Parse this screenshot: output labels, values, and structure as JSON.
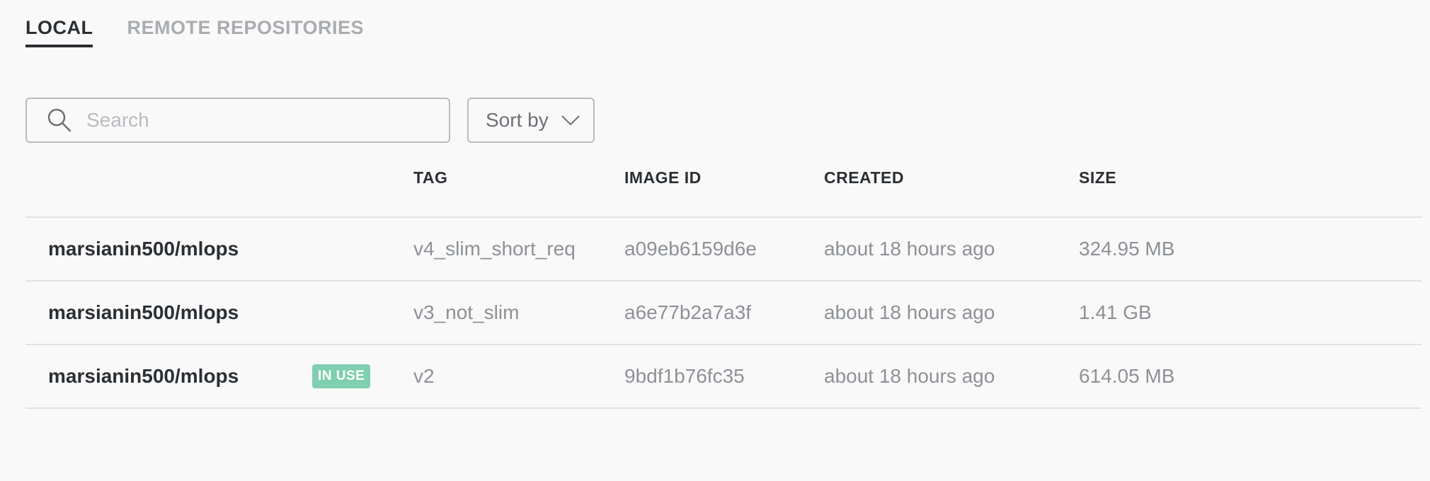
{
  "tabs": [
    {
      "label": "LOCAL",
      "active": true
    },
    {
      "label": "REMOTE REPOSITORIES",
      "active": false
    }
  ],
  "search": {
    "placeholder": "Search",
    "value": "",
    "icon": "search-icon"
  },
  "sort": {
    "label": "Sort by",
    "icon": "chevron-down-icon"
  },
  "table": {
    "columns": [
      "TAG",
      "IMAGE ID",
      "CREATED",
      "SIZE"
    ],
    "rows": [
      {
        "repository": "marsianin500/mlops",
        "in_use": false,
        "tag": "v4_slim_short_req",
        "image_id": "a09eb6159d6e",
        "created": "about 18 hours ago",
        "size": "324.95 MB"
      },
      {
        "repository": "marsianin500/mlops",
        "in_use": false,
        "tag": "v3_not_slim",
        "image_id": "a6e77b2a7a3f",
        "created": "about 18 hours ago",
        "size": "1.41 GB"
      },
      {
        "repository": "marsianin500/mlops",
        "in_use": true,
        "badge": "IN USE",
        "tag": "v2",
        "image_id": "9bdf1b76fc35",
        "created": "about 18 hours ago",
        "size": "614.05 MB"
      }
    ]
  },
  "colors": {
    "accent_badge": "#7fcfb0",
    "text_primary": "#2b2f33",
    "text_secondary": "#8d9196",
    "background": "#f9f9f9"
  }
}
